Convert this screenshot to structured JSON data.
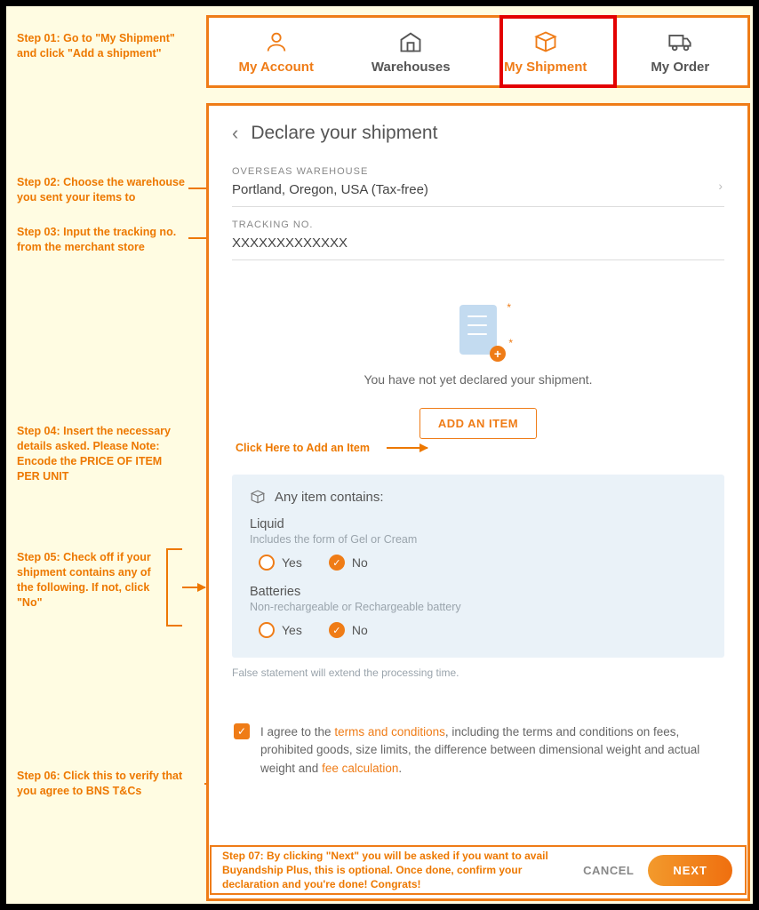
{
  "steps": {
    "s1": "Step 01: Go to \"My Shipment\" and click \"Add a shipment\"",
    "s2": "Step 02: Choose the warehouse you sent your items to",
    "s3": "Step 03: Input the tracking no. from the merchant store",
    "s4": "Step 04: Insert the necessary details asked. Please Note: Encode the PRICE OF ITEM PER UNIT",
    "s5": "Step 05: Check off if your shipment contains any of the following. If not, click \"No\"",
    "s6": "Step 06: Click this to verify that you agree to BNS T&Cs",
    "s7": "Step 07: By clicking \"Next\" you will be asked if you want to avail Buyandship Plus, this is optional. Once done, confirm your declaration and you're done! Congrats!",
    "add_callout": "Click Here to Add an Item"
  },
  "nav": {
    "account": "My Account",
    "warehouses": "Warehouses",
    "shipment": "My Shipment",
    "order": "My Order"
  },
  "form": {
    "title": "Declare your shipment",
    "warehouse_label": "OVERSEAS WAREHOUSE",
    "warehouse_value": "Portland, Oregon, USA (Tax-free)",
    "tracking_label": "TRACKING NO.",
    "tracking_value": "XXXXXXXXXXXXX",
    "not_declared": "You have not yet declared your shipment.",
    "add_item": "ADD AN ITEM"
  },
  "contains": {
    "title": "Any item contains:",
    "liquid_label": "Liquid",
    "liquid_sub": "Includes the form of Gel or Cream",
    "batt_label": "Batteries",
    "batt_sub": "Non-rechargeable or Rechargeable battery",
    "yes": "Yes",
    "no": "No",
    "disclaimer": "False statement will extend the processing time."
  },
  "agree": {
    "pre": "I agree to the ",
    "link1": "terms and conditions",
    "mid": ", including the terms and conditions on fees, prohibited goods, size limits, the difference between dimensional weight and actual weight and ",
    "link2": "fee calculation",
    "post": "."
  },
  "buttons": {
    "cancel": "CANCEL",
    "next": "NEXT"
  }
}
